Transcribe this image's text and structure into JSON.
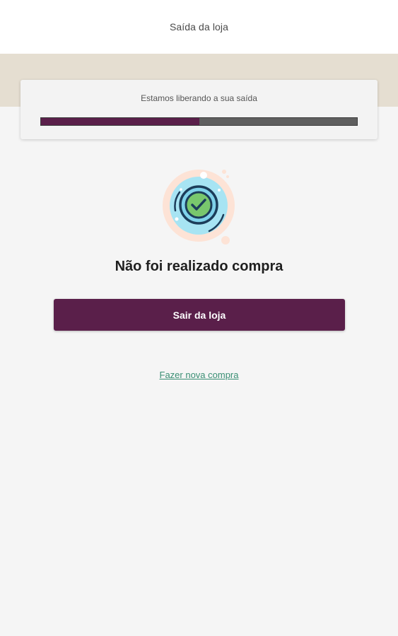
{
  "header": {
    "title": "Saída da loja"
  },
  "status": {
    "message": "Estamos liberando a sua saída",
    "progress": 0.5,
    "progress_color": "#5a1f4a",
    "track_color": "#5f5f5f"
  },
  "illustration": {
    "icon": "check-circle-icon"
  },
  "result": {
    "headline": "Não foi realizado compra"
  },
  "actions": {
    "exit_label": "Sair da loja",
    "new_purchase_label": "Fazer nova compra"
  },
  "colors": {
    "brand": "#5a1f4a",
    "link": "#3a8f74",
    "band": "#e5ded1",
    "background": "#f5f5f5"
  }
}
